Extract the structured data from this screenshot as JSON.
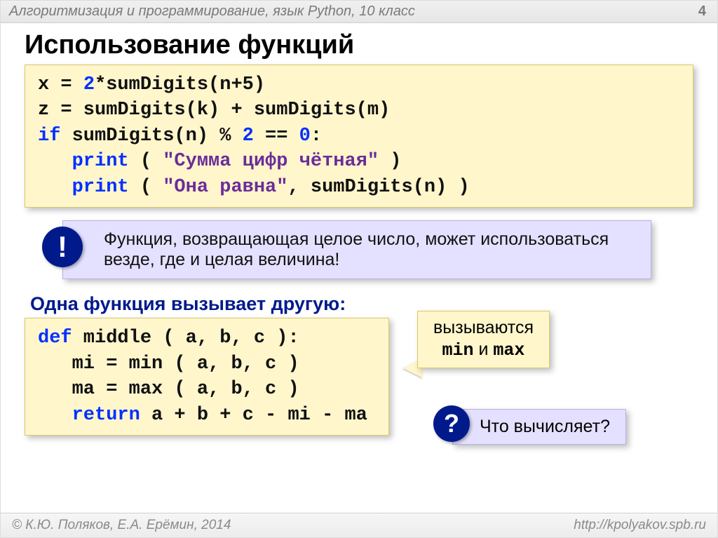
{
  "header": {
    "course": "Алгоритмизация и программирование, язык Python, 10 класс",
    "page_number": "4"
  },
  "title": "Использование функций",
  "code1": {
    "l1a": "x = ",
    "l1b": "2",
    "l1c": "*sumDigits(n+5)",
    "l2": "z = sumDigits(k) + sumDigits(m)",
    "l3a": "if",
    "l3b": " sumDigits(n) % ",
    "l3c": "2",
    "l3d": " == ",
    "l3e": "0",
    "l3f": ":",
    "l4a": "   ",
    "l4b": "print",
    "l4c": " ( ",
    "l4d": "\"Сумма цифр чётная\"",
    "l4e": " )",
    "l5a": "   ",
    "l5b": "print",
    "l5c": " ( ",
    "l5d": "\"Она равна\"",
    "l5e": ", sumDigits(n) )"
  },
  "info": {
    "badge": "!",
    "text": "Функция, возвращающая целое число, может использоваться везде, где и целая величина!"
  },
  "subtitle": "Одна функция вызывает другую:",
  "code2": {
    "l1a": "def",
    "l1b": " middle ( a, b, c ):",
    "l2": "   mi = min ( a, b, c )",
    "l3": "   ma = max ( a, b, c )",
    "l4a": "   ",
    "l4b": "return",
    "l4c": " a + b + c - mi - ma"
  },
  "callout": {
    "line1": "вызываются",
    "min": "min",
    "and_word": " и ",
    "max": "max"
  },
  "question": {
    "badge": "?",
    "text": "Что вычисляет?"
  },
  "footer": {
    "authors": "© К.Ю. Поляков, Е.А. Ерёмин, 2014",
    "url": "http://kpolyakov.spb.ru"
  }
}
